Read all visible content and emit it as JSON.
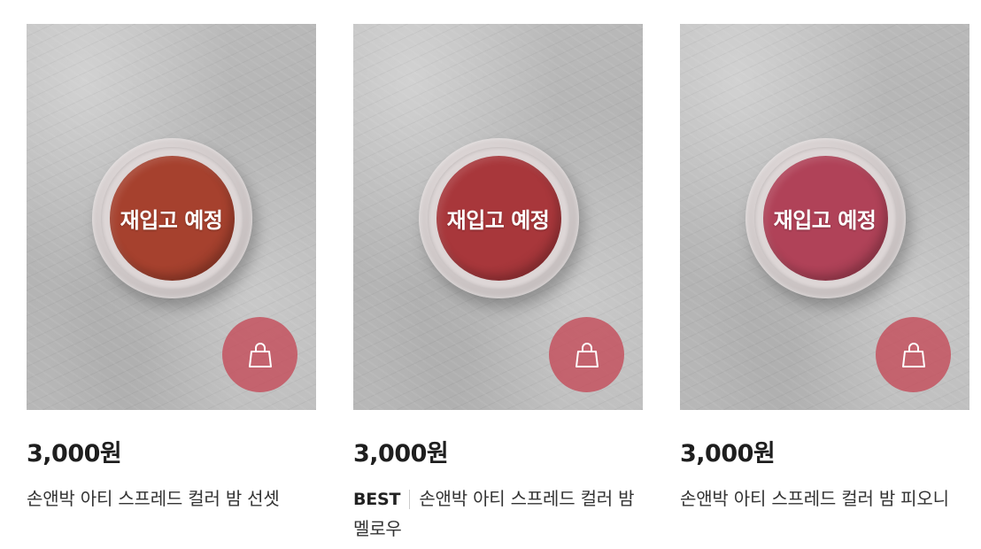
{
  "products": [
    {
      "overlay": "재입고 예정",
      "price": "3,000원",
      "badge": "",
      "name": "손앤박 아티 스프레드 컬러 밤 선셋",
      "balm_color": "#a6412e",
      "cart_icon": "shopping-bag-icon"
    },
    {
      "overlay": "재입고 예정",
      "price": "3,000원",
      "badge": "BEST",
      "name": "손앤박 아티 스프레드 컬러 밤 멜로우",
      "balm_color": "#a8373b",
      "cart_icon": "shopping-bag-icon"
    },
    {
      "overlay": "재입고 예정",
      "price": "3,000원",
      "badge": "",
      "name": "손앤박 아티 스프레드 컬러 밤 피오니",
      "balm_color": "#b04258",
      "cart_icon": "shopping-bag-icon"
    }
  ],
  "colors": {
    "cart_button": "#c44856",
    "overlay_text": "#ffffff"
  }
}
